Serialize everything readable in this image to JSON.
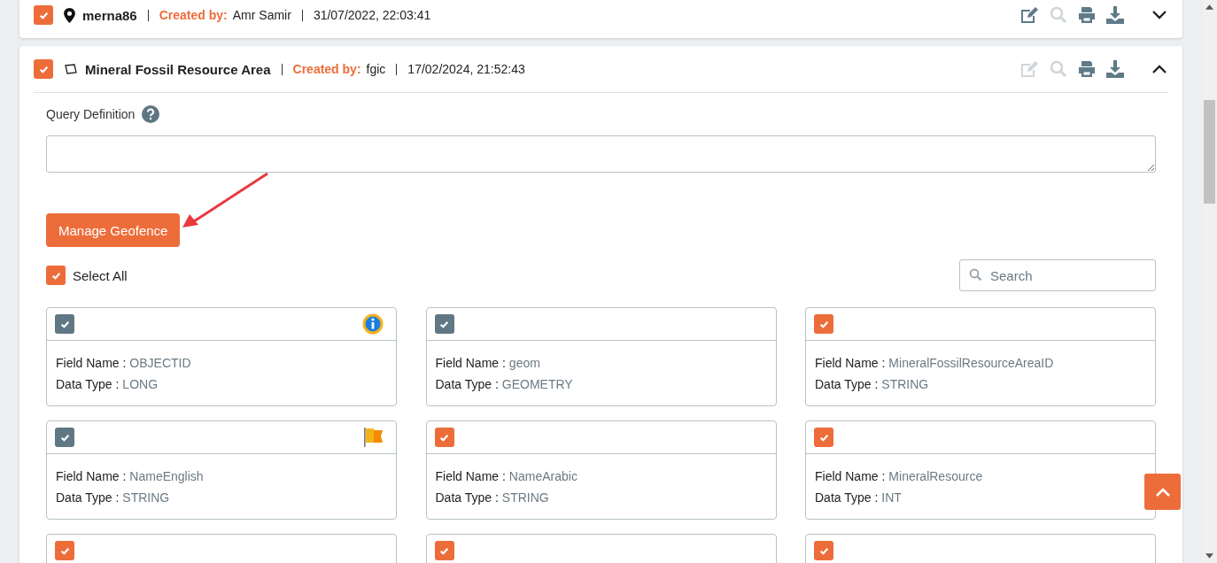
{
  "layers": [
    {
      "kind": "point",
      "name": "merna86",
      "created_by_label": "Created by:",
      "created_by": "Amr Samir",
      "date": "31/07/2022, 22:03:41",
      "checked": true,
      "expanded": false,
      "actions": [
        {
          "kind": "edit",
          "disabled": false
        },
        {
          "kind": "search",
          "disabled": true
        },
        {
          "kind": "print",
          "disabled": false
        },
        {
          "kind": "download",
          "disabled": false
        }
      ]
    },
    {
      "kind": "polygon",
      "name": "Mineral Fossil Resource Area",
      "created_by_label": "Created by:",
      "created_by": "fgic",
      "date": "17/02/2024, 21:52:43",
      "checked": true,
      "expanded": true,
      "actions": [
        {
          "kind": "edit",
          "disabled": true
        },
        {
          "kind": "search",
          "disabled": true
        },
        {
          "kind": "print",
          "disabled": false
        },
        {
          "kind": "download",
          "disabled": false
        }
      ],
      "query_label": "Query Definition",
      "manage_button": "Manage Geofence",
      "select_all": {
        "label": "Select All",
        "checked": true
      },
      "search": {
        "placeholder": "Search"
      },
      "fields": [
        {
          "checked": true,
          "disabled": true,
          "info": true,
          "flagged": false,
          "name_label": "Field Name :",
          "name": "OBJECTID",
          "type_label": "Data Type :",
          "type": "LONG"
        },
        {
          "checked": true,
          "disabled": true,
          "info": false,
          "flagged": false,
          "name_label": "Field Name :",
          "name": "geom",
          "type_label": "Data Type :",
          "type": "GEOMETRY"
        },
        {
          "checked": true,
          "disabled": false,
          "info": false,
          "flagged": false,
          "name_label": "Field Name :",
          "name": "MineralFossilResourceAreaID",
          "type_label": "Data Type :",
          "type": "STRING"
        },
        {
          "checked": true,
          "disabled": true,
          "info": false,
          "flagged": true,
          "name_label": "Field Name :",
          "name": "NameEnglish",
          "type_label": "Data Type :",
          "type": "STRING"
        },
        {
          "checked": true,
          "disabled": false,
          "info": false,
          "flagged": false,
          "name_label": "Field Name :",
          "name": "NameArabic",
          "type_label": "Data Type :",
          "type": "STRING"
        },
        {
          "checked": true,
          "disabled": false,
          "info": false,
          "flagged": false,
          "name_label": "Field Name :",
          "name": "MineralResource",
          "type_label": "Data Type :",
          "type": "INT"
        },
        {
          "checked": true,
          "disabled": false,
          "info": false,
          "flagged": false
        },
        {
          "checked": true,
          "disabled": false,
          "info": false,
          "flagged": false
        },
        {
          "checked": true,
          "disabled": false,
          "info": false,
          "flagged": false
        }
      ]
    }
  ]
}
